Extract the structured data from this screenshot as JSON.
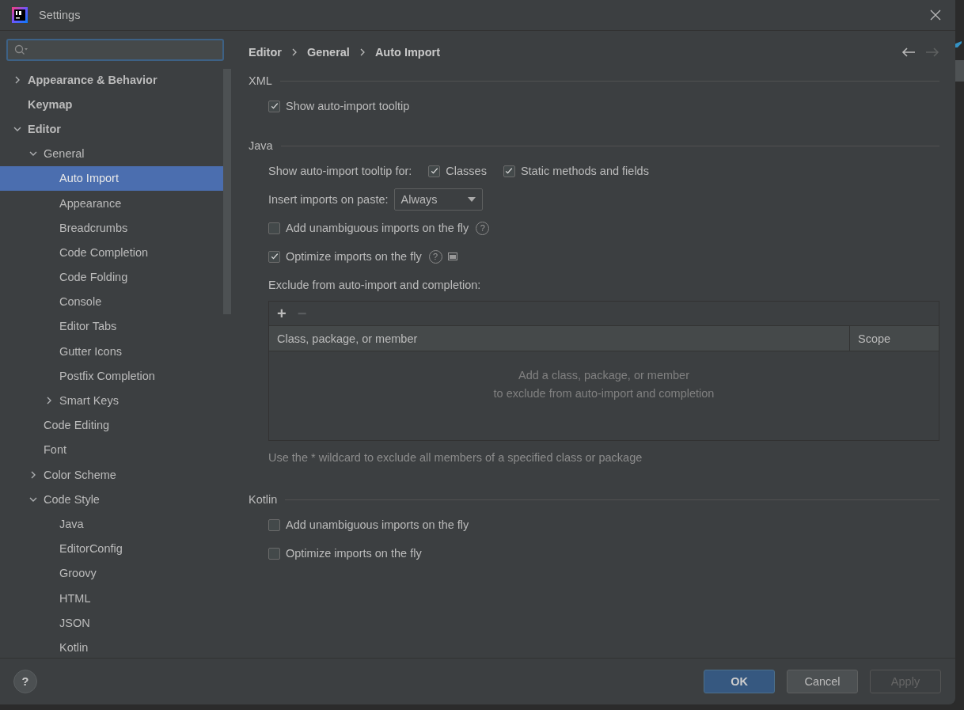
{
  "window": {
    "title": "Settings"
  },
  "search": {
    "focused": true
  },
  "tree": [
    {
      "label": "Appearance & Behavior",
      "expanded": false,
      "selected": false
    },
    {
      "label": "Keymap",
      "selected": false
    },
    {
      "label": "Editor",
      "expanded": true,
      "selected": false,
      "children": [
        {
          "label": "General",
          "expanded": true,
          "selected": false,
          "children": [
            {
              "label": "Auto Import",
              "selected": true
            },
            {
              "label": "Appearance",
              "selected": false
            },
            {
              "label": "Breadcrumbs",
              "selected": false
            },
            {
              "label": "Code Completion",
              "selected": false
            },
            {
              "label": "Code Folding",
              "selected": false
            },
            {
              "label": "Console",
              "selected": false
            },
            {
              "label": "Editor Tabs",
              "selected": false
            },
            {
              "label": "Gutter Icons",
              "selected": false
            },
            {
              "label": "Postfix Completion",
              "selected": false
            },
            {
              "label": "Smart Keys",
              "expanded": false,
              "selected": false
            }
          ]
        },
        {
          "label": "Code Editing",
          "selected": false
        },
        {
          "label": "Font",
          "selected": false
        },
        {
          "label": "Color Scheme",
          "expanded": false,
          "selected": false
        },
        {
          "label": "Code Style",
          "expanded": true,
          "selected": false,
          "children": [
            {
              "label": "Java",
              "selected": false
            },
            {
              "label": "EditorConfig",
              "selected": false
            },
            {
              "label": "Groovy",
              "selected": false
            },
            {
              "label": "HTML",
              "selected": false
            },
            {
              "label": "JSON",
              "selected": false
            },
            {
              "label": "Kotlin",
              "selected": false
            }
          ]
        }
      ]
    }
  ],
  "breadcrumbs": [
    "Editor",
    "General",
    "Auto Import"
  ],
  "nav": {
    "back_disabled": false,
    "forward_disabled": true
  },
  "sections": [
    {
      "title": "XML",
      "rows": [
        {
          "kind": "checkbox",
          "label": "Show auto-import tooltip",
          "checked": true
        }
      ]
    },
    {
      "title": "Java",
      "rows": [
        {
          "kind": "checks",
          "label": "Show auto-import tooltip for:",
          "options": [
            {
              "label": "Classes",
              "checked": true
            },
            {
              "label": "Static methods and fields",
              "checked": true
            }
          ]
        },
        {
          "kind": "dropdown",
          "label": "Insert imports on paste:",
          "value": "Always"
        },
        {
          "kind": "checkbox",
          "label": "Add unambiguous imports on the fly",
          "checked": false,
          "help": "?"
        },
        {
          "kind": "checkbox",
          "label": "Optimize imports on the fly",
          "checked": true,
          "help": "?",
          "extra_icon": true
        },
        {
          "kind": "label",
          "label": "Exclude from auto-import and completion:"
        },
        {
          "kind": "table",
          "toolbar": [
            {
              "symbol": "+",
              "disabled": false
            },
            {
              "symbol": "−",
              "disabled": true
            }
          ],
          "columns": [
            "Class, package, or member",
            "Scope"
          ],
          "empty_text": [
            "Add a class, package, or member",
            "to exclude from auto-import and completion"
          ]
        },
        {
          "kind": "hint",
          "label": "Use the * wildcard to exclude all members of a specified class or package"
        }
      ]
    },
    {
      "title": "Kotlin",
      "rows": [
        {
          "kind": "checkbox",
          "label": "Add unambiguous imports on the fly",
          "checked": false
        },
        {
          "kind": "checkbox",
          "label": "Optimize imports on the fly",
          "checked": false
        }
      ]
    }
  ],
  "footer": {
    "help": "?",
    "buttons": [
      {
        "label": "OK",
        "default": true,
        "disabled": false
      },
      {
        "label": "Cancel",
        "default": false,
        "disabled": false
      },
      {
        "label": "Apply",
        "default": false,
        "disabled": true
      }
    ]
  }
}
